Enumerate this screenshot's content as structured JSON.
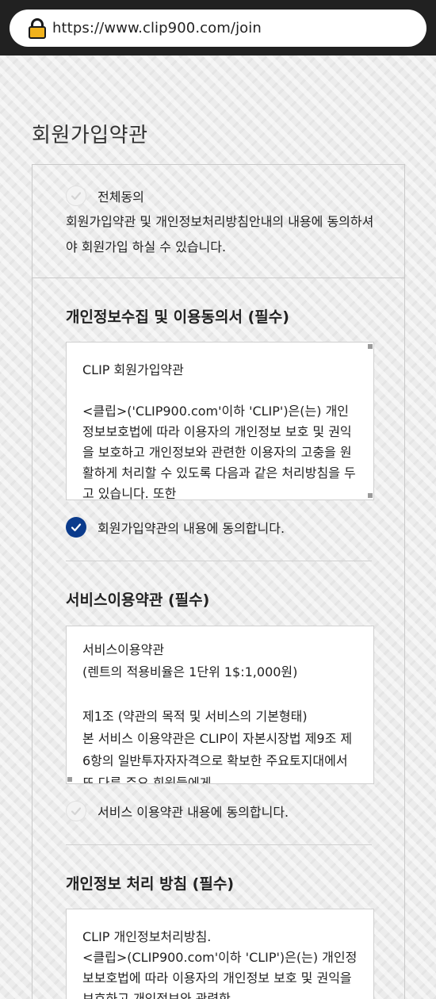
{
  "browser": {
    "url": "https://www.clip900.com/join"
  },
  "page": {
    "title": "회원가입약관"
  },
  "agree_all": {
    "label": "전체동의",
    "description": "회원가입약관 및 개인정보처리방침안내의 내용에 동의하셔야 회원가입 하실 수 있습니다.",
    "checked": false
  },
  "sections": [
    {
      "title": "개인정보수집 및 이용동의서 (필수)",
      "terms_text": "CLIP 회원가입약관\n\n<클립>('CLIP900.com'이하 'CLIP')은(는) 개인정보보호법에 따라 이용자의 개인정보 보호 및 권익을 보호하고 개인정보와 관련한 이용자의 고충을 원활하게 처리할 수 있도록 다음과 같은 처리방침을 두고 있습니다. 또한",
      "agree_label": "회원가입약관의 내용에 동의합니다.",
      "checked": true
    },
    {
      "title": "서비스이용약관 (필수)",
      "terms_text": "서비스이용약관\n(렌트의 적용비율은 1단위 1$:1,000원)\n\n제1조 (약관의 목적 및 서비스의 기본형태)\n본 서비스 이용약관은 CLIP이 자본시장법 제9조 제6항의 일반투자자자격으로 확보한 주요토지대에서 또 다른 주요 회원들에게",
      "agree_label": "서비스 이용약관 내용에 동의합니다.",
      "checked": false
    },
    {
      "title": "개인정보 처리 방침 (필수)",
      "terms_text": "CLIP 개인정보처리방침.\n<클립>(CLIP900.com'이하 'CLIP')은(는) 개인정보보호법에 따라 이용자의 개인정보 보호 및 권익을 보호하고 개인정보와 관련한"
    }
  ],
  "colors": {
    "checked": "#0b3b8c",
    "unchecked": "#f3f3f3",
    "browser_bar": "#212121",
    "lock": "#f1b21c"
  }
}
